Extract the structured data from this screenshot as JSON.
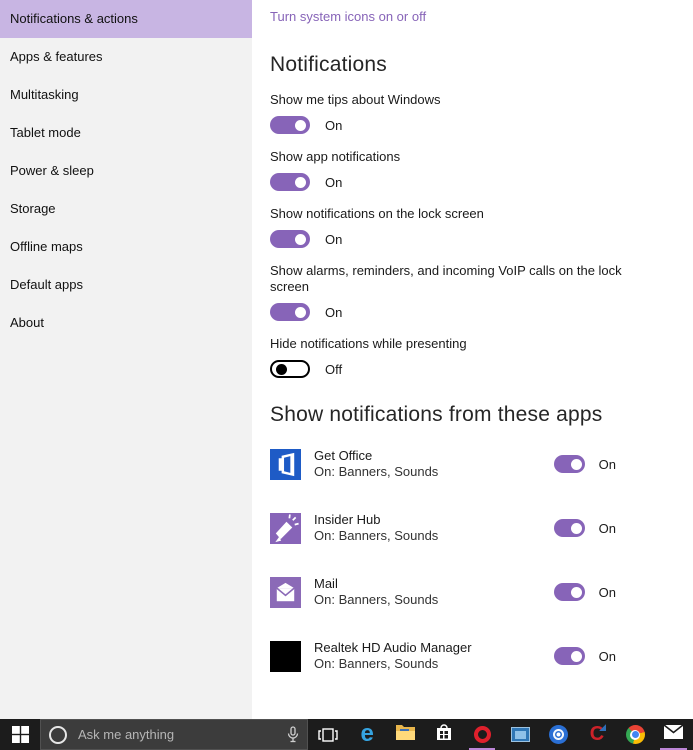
{
  "sidebar": {
    "items": [
      {
        "label": "Notifications & actions",
        "selected": true
      },
      {
        "label": "Apps & features",
        "selected": false
      },
      {
        "label": "Multitasking",
        "selected": false
      },
      {
        "label": "Tablet mode",
        "selected": false
      },
      {
        "label": "Power & sleep",
        "selected": false
      },
      {
        "label": "Storage",
        "selected": false
      },
      {
        "label": "Offline maps",
        "selected": false
      },
      {
        "label": "Default apps",
        "selected": false
      },
      {
        "label": "About",
        "selected": false
      }
    ]
  },
  "content": {
    "top_link": "Turn system icons on or off",
    "notifications_title": "Notifications",
    "toggles": [
      {
        "label": "Show me tips about Windows",
        "state": "On"
      },
      {
        "label": "Show app notifications",
        "state": "On"
      },
      {
        "label": "Show notifications on the lock screen",
        "state": "On"
      },
      {
        "label": "Show alarms, reminders, and incoming VoIP calls on the lock screen",
        "state": "On"
      },
      {
        "label": "Hide notifications while presenting",
        "state": "Off"
      }
    ],
    "apps_title": "Show notifications from these apps",
    "apps": [
      {
        "name": "Get Office",
        "detail": "On: Banners, Sounds",
        "state": "On",
        "icon": "office-icon"
      },
      {
        "name": "Insider Hub",
        "detail": "On: Banners, Sounds",
        "state": "On",
        "icon": "megaphone-icon"
      },
      {
        "name": "Mail",
        "detail": "On: Banners, Sounds",
        "state": "On",
        "icon": "mail-app-icon"
      },
      {
        "name": "Realtek HD Audio Manager",
        "detail": "On: Banners, Sounds",
        "state": "On",
        "icon": "realtek-icon"
      }
    ]
  },
  "taskbar": {
    "start_icon": "windows-logo-icon",
    "search": {
      "placeholder": "Ask me anything",
      "leading_icon": "cortana-circle-icon",
      "trailing_icon": "microphone-icon"
    },
    "task_view_icon": "task-view-icon",
    "app_icons": [
      {
        "name": "edge",
        "running": false
      },
      {
        "name": "file-explorer",
        "running": false
      },
      {
        "name": "store",
        "running": false
      },
      {
        "name": "opera",
        "running": true
      },
      {
        "name": "display-settings",
        "running": false
      },
      {
        "name": "disc-utility",
        "running": false
      },
      {
        "name": "ccleaner",
        "running": false
      },
      {
        "name": "chrome",
        "running": false
      },
      {
        "name": "mail",
        "running": true
      }
    ]
  },
  "colors": {
    "accent_purple": "#8764b8",
    "sidebar_selected": "#c8b5e3",
    "link_purple": "#8764b8",
    "taskbar_bg": "#1c1c1c",
    "running_indicator": "#bd86d7"
  }
}
